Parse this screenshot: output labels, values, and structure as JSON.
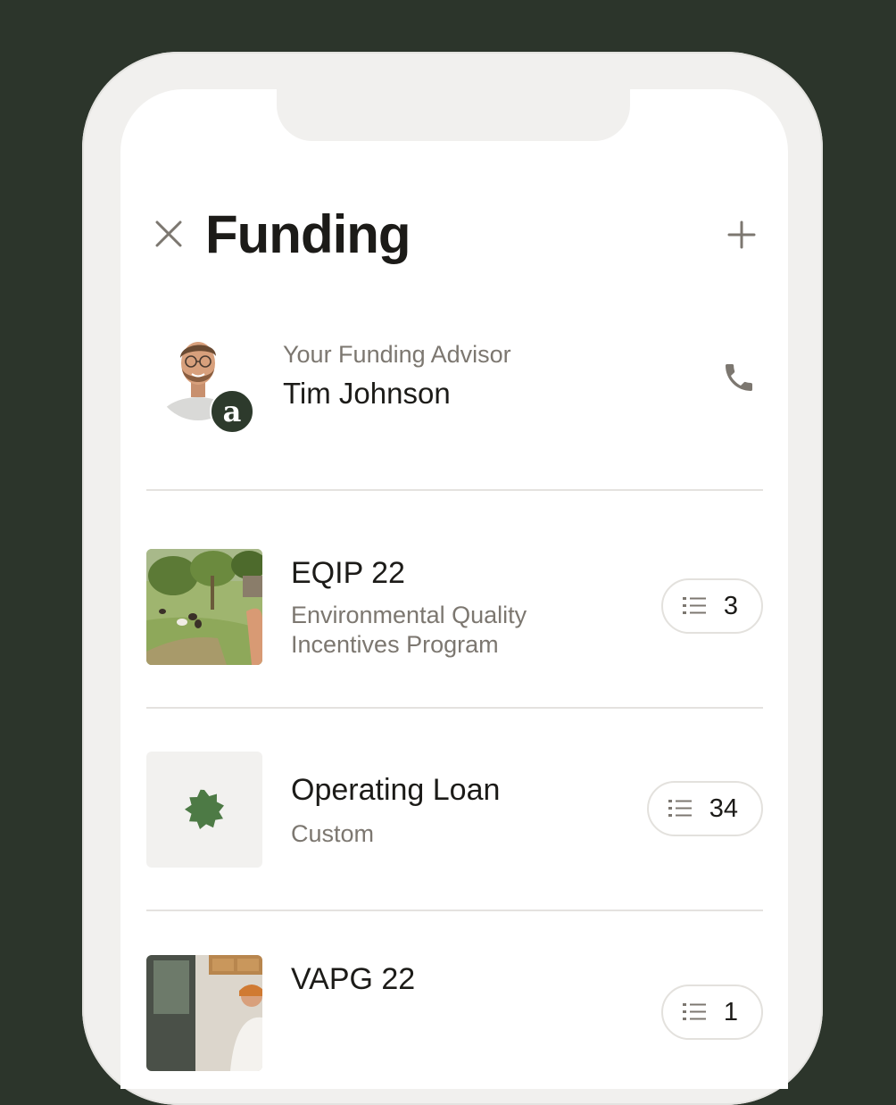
{
  "header": {
    "title": "Funding"
  },
  "advisor": {
    "label": "Your Funding Advisor",
    "name": "Tim Johnson",
    "badge_letter": "a"
  },
  "funding_items": [
    {
      "title": "EQIP 22",
      "subtitle": "Environmental Quality Incentives Program",
      "task_count": "3"
    },
    {
      "title": "Operating Loan",
      "subtitle": "Custom",
      "task_count": "34"
    },
    {
      "title": "VAPG 22",
      "subtitle": "",
      "task_count": "1"
    }
  ],
  "icons": {
    "close": "close-icon",
    "add": "plus-icon",
    "phone": "phone-icon",
    "task_list": "list-icon",
    "badge": "starburst-badge-icon"
  },
  "colors": {
    "background": "#2c352b",
    "title_text": "#1c1b18",
    "secondary_text": "#7c7770",
    "accent_green": "#4d7a45",
    "advisor_badge": "#2d3a2c"
  }
}
